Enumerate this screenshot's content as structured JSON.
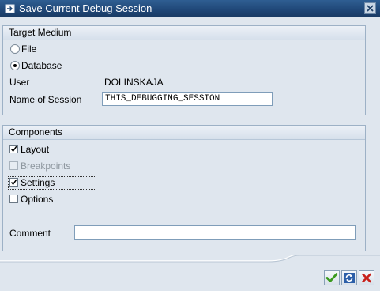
{
  "window": {
    "title": "Save Current Debug Session"
  },
  "target_medium": {
    "title": "Target Medium",
    "options": [
      {
        "label": "File",
        "selected": false
      },
      {
        "label": "Database",
        "selected": true
      }
    ],
    "user_label": "User",
    "user_value": "DOLINSKAJA",
    "session_label": "Name of Session",
    "session_value": "THIS_DEBUGGING_SESSION"
  },
  "components": {
    "title": "Components",
    "items": [
      {
        "label": "Layout",
        "checked": true,
        "enabled": true
      },
      {
        "label": "Breakpoints",
        "checked": false,
        "enabled": false
      },
      {
        "label": "Settings",
        "checked": true,
        "enabled": true
      },
      {
        "label": "Options",
        "checked": false,
        "enabled": true
      }
    ],
    "comment_label": "Comment",
    "comment_value": ""
  },
  "buttons": {
    "confirm_icon": "checkmark-icon",
    "refresh_icon": "refresh-icon",
    "cancel_icon": "cancel-x-icon"
  },
  "colors": {
    "titlebar": "#1f4676",
    "background": "#dfe6ee",
    "confirm_green": "#3a9a1e",
    "cancel_red": "#c8201a"
  }
}
